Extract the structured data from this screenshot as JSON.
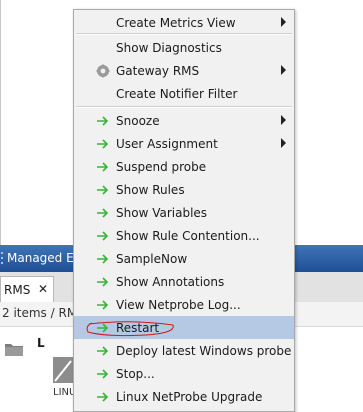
{
  "panel": {
    "title": "Managed Ent"
  },
  "tab": {
    "label": "RMS",
    "close": "✕"
  },
  "summary": {
    "text": "2 items  / RM"
  },
  "content": {
    "column_header": "L",
    "probe_label": "LINU"
  },
  "menu": {
    "items": [
      {
        "label": "Create Metrics View",
        "icon": "none",
        "submenu": true
      },
      {
        "label": "Show Diagnostics",
        "icon": "none",
        "submenu": false
      },
      {
        "label": "Gateway RMS",
        "icon": "gear-icon",
        "submenu": true
      },
      {
        "label": "Create Notifier Filter",
        "icon": "none",
        "submenu": false
      },
      {
        "label": "Snooze",
        "icon": "green-arrow-icon",
        "submenu": true
      },
      {
        "label": "User Assignment",
        "icon": "green-arrow-icon",
        "submenu": true
      },
      {
        "label": "Suspend probe",
        "icon": "green-arrow-icon",
        "submenu": false
      },
      {
        "label": "Show Rules",
        "icon": "green-arrow-icon",
        "submenu": false
      },
      {
        "label": "Show Variables",
        "icon": "green-arrow-icon",
        "submenu": false
      },
      {
        "label": "Show Rule Contention...",
        "icon": "green-arrow-icon",
        "submenu": false
      },
      {
        "label": "SampleNow",
        "icon": "green-arrow-icon",
        "submenu": false
      },
      {
        "label": "Show Annotations",
        "icon": "green-arrow-icon",
        "submenu": false
      },
      {
        "label": "View Netprobe Log...",
        "icon": "green-arrow-icon",
        "submenu": false
      },
      {
        "label": "Restart",
        "icon": "green-arrow-icon",
        "submenu": false,
        "selected": true
      },
      {
        "label": "Deploy latest Windows probe",
        "icon": "green-arrow-icon",
        "submenu": false
      },
      {
        "label": "Stop...",
        "icon": "green-arrow-icon",
        "submenu": false
      },
      {
        "label": "Linux NetProbe Upgrade",
        "icon": "green-arrow-icon",
        "submenu": false
      }
    ]
  },
  "colors": {
    "menu_bg": "#f1f1f1",
    "selection": "#b5c9e4",
    "arrow": "#3bb23b",
    "header_blue": "#2c5fa5",
    "annotation_red": "#d01818"
  }
}
